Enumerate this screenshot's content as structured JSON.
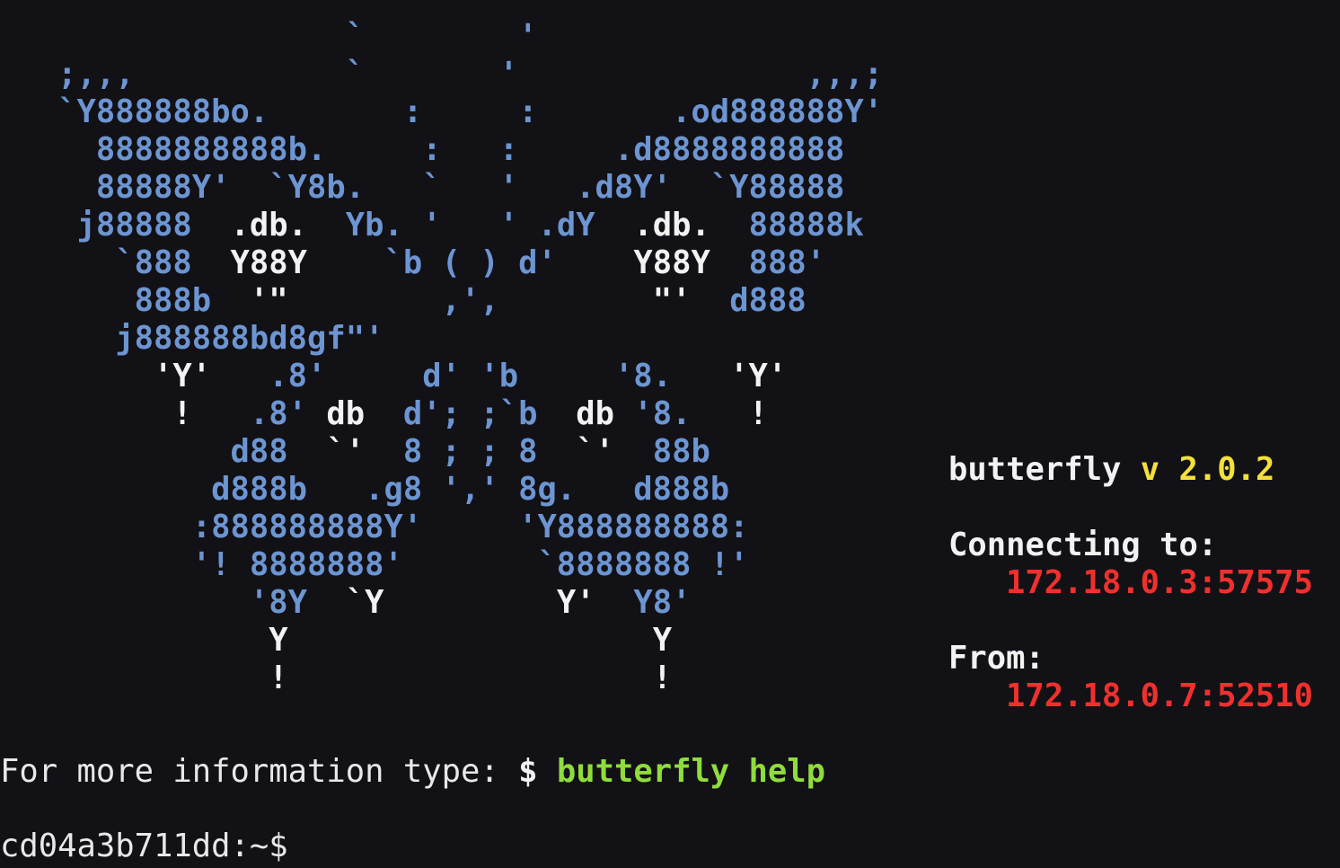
{
  "art": [
    [
      {
        "t": "                  `        '",
        "c": "blue"
      }
    ],
    [
      {
        "t": "   ;,,,           `       '               ,,,;",
        "c": "blue"
      }
    ],
    [
      {
        "t": "   `Y888888bo.       :     :       .od888888Y'",
        "c": "blue"
      }
    ],
    [
      {
        "t": "     8888888888b.     :   :     .d8888888888",
        "c": "blue"
      }
    ],
    [
      {
        "t": "     88888Y'  `Y8b.   `   '   .d8Y'  `Y88888",
        "c": "blue"
      }
    ],
    [
      {
        "t": "    j88888  ",
        "c": "blue"
      },
      {
        "t": ".db.",
        "c": "white"
      },
      {
        "t": "  Yb. '   ' .dY  ",
        "c": "blue"
      },
      {
        "t": ".db.",
        "c": "white"
      },
      {
        "t": "  88888k",
        "c": "blue"
      }
    ],
    [
      {
        "t": "      `888  ",
        "c": "blue"
      },
      {
        "t": "Y88Y",
        "c": "white"
      },
      {
        "t": "    `b ( ) d'    ",
        "c": "blue"
      },
      {
        "t": "Y88Y",
        "c": "white"
      },
      {
        "t": "  888'",
        "c": "blue"
      }
    ],
    [
      {
        "t": "       888b  ",
        "c": "blue"
      },
      {
        "t": "'\"",
        "c": "white"
      },
      {
        "t": "        ,',        ",
        "c": "blue"
      },
      {
        "t": "\"'",
        "c": "white"
      },
      {
        "t": "  d888",
        "c": "blue"
      }
    ],
    [
      {
        "t": "      j888888bd8gf\"'",
        "c": "blue"
      }
    ],
    [
      {
        "t": "        ",
        "c": "blue"
      },
      {
        "t": "'Y'",
        "c": "white"
      },
      {
        "t": "   .8'     d' 'b     '8.   ",
        "c": "blue"
      },
      {
        "t": "'Y'",
        "c": "white"
      }
    ],
    [
      {
        "t": "         ",
        "c": "blue"
      },
      {
        "t": "!",
        "c": "white"
      },
      {
        "t": "   .8' ",
        "c": "blue"
      },
      {
        "t": "db",
        "c": "white"
      },
      {
        "t": "  d'; ;`b  ",
        "c": "blue"
      },
      {
        "t": "db",
        "c": "white"
      },
      {
        "t": " '8.   ",
        "c": "blue"
      },
      {
        "t": "!",
        "c": "white"
      }
    ],
    [
      {
        "t": "            d88  ",
        "c": "blue"
      },
      {
        "t": "`'",
        "c": "white"
      },
      {
        "t": "  8 ; ; 8  ",
        "c": "blue"
      },
      {
        "t": "`'",
        "c": "white"
      },
      {
        "t": "  88b",
        "c": "blue"
      }
    ],
    [
      {
        "t": "           d888b   .g8 ',' 8g.   d888b",
        "c": "blue"
      }
    ],
    [
      {
        "t": "          :888888888Y'     'Y888888888:",
        "c": "blue"
      }
    ],
    [
      {
        "t": "          '! 8888888'       `8888888 !'",
        "c": "blue"
      }
    ],
    [
      {
        "t": "             '8Y  ",
        "c": "blue"
      },
      {
        "t": "`Y",
        "c": "white"
      },
      {
        "t": "         ",
        "c": "blue"
      },
      {
        "t": "Y'",
        "c": "white"
      },
      {
        "t": "  Y8'",
        "c": "blue"
      }
    ],
    [
      {
        "t": "              ",
        "c": "blue"
      },
      {
        "t": "Y",
        "c": "white"
      },
      {
        "t": "                   ",
        "c": "blue"
      },
      {
        "t": "Y",
        "c": "white"
      }
    ],
    [
      {
        "t": "              ",
        "c": "blue"
      },
      {
        "t": "!",
        "c": "white"
      },
      {
        "t": "                   ",
        "c": "blue"
      },
      {
        "t": "!",
        "c": "white"
      }
    ]
  ],
  "info": {
    "app_name": "butterfly",
    "version": "v 2.0.2",
    "connecting_label": "Connecting to:",
    "connecting_address": "172.18.0.3:57575",
    "from_label": "From:",
    "from_address": "172.18.0.7:52510"
  },
  "help": {
    "prefix": "For more information type: ",
    "dollar": "$ ",
    "command": "butterfly help"
  },
  "prompt": {
    "text": "cd04a3b711dd:~$ "
  },
  "colors": {
    "background": "#121116",
    "art_blue": "#6c95d2",
    "art_white": "#f2f2f2",
    "version_yellow": "#f3e03c",
    "address_red": "#f0302d",
    "command_green": "#8fdc3c"
  }
}
